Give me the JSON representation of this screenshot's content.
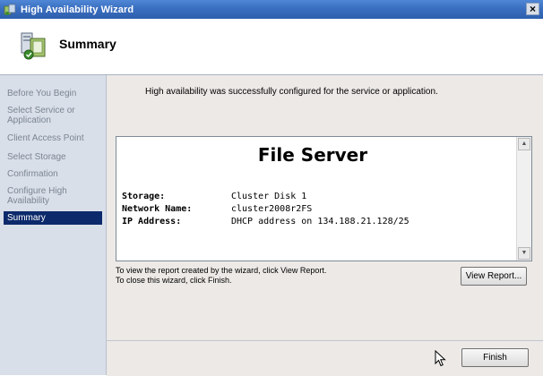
{
  "window": {
    "title": "High Availability Wizard",
    "close_label": "×"
  },
  "header": {
    "title": "Summary"
  },
  "nav": {
    "items": [
      {
        "label": "Before You Begin"
      },
      {
        "label": "Select Service or Application"
      },
      {
        "label": "Client Access Point"
      },
      {
        "label": "Select Storage"
      },
      {
        "label": "Confirmation"
      },
      {
        "label": "Configure High Availability"
      },
      {
        "label": "Summary"
      }
    ]
  },
  "main": {
    "message": "High availability was successfully configured for the service or application.",
    "report": {
      "title": "File Server",
      "rows": [
        {
          "label": "Storage:",
          "value": "Cluster Disk 1"
        },
        {
          "label": "Network Name:",
          "value": "cluster2008r2FS"
        },
        {
          "label": "IP Address:",
          "value": "DHCP address on 134.188.21.128/25"
        }
      ]
    },
    "hint_line1": "To view the report created by the wizard, click View Report.",
    "hint_line2": "To close this wizard, click Finish.",
    "view_report_label": "View Report..."
  },
  "footer": {
    "finish_label": "Finish"
  }
}
